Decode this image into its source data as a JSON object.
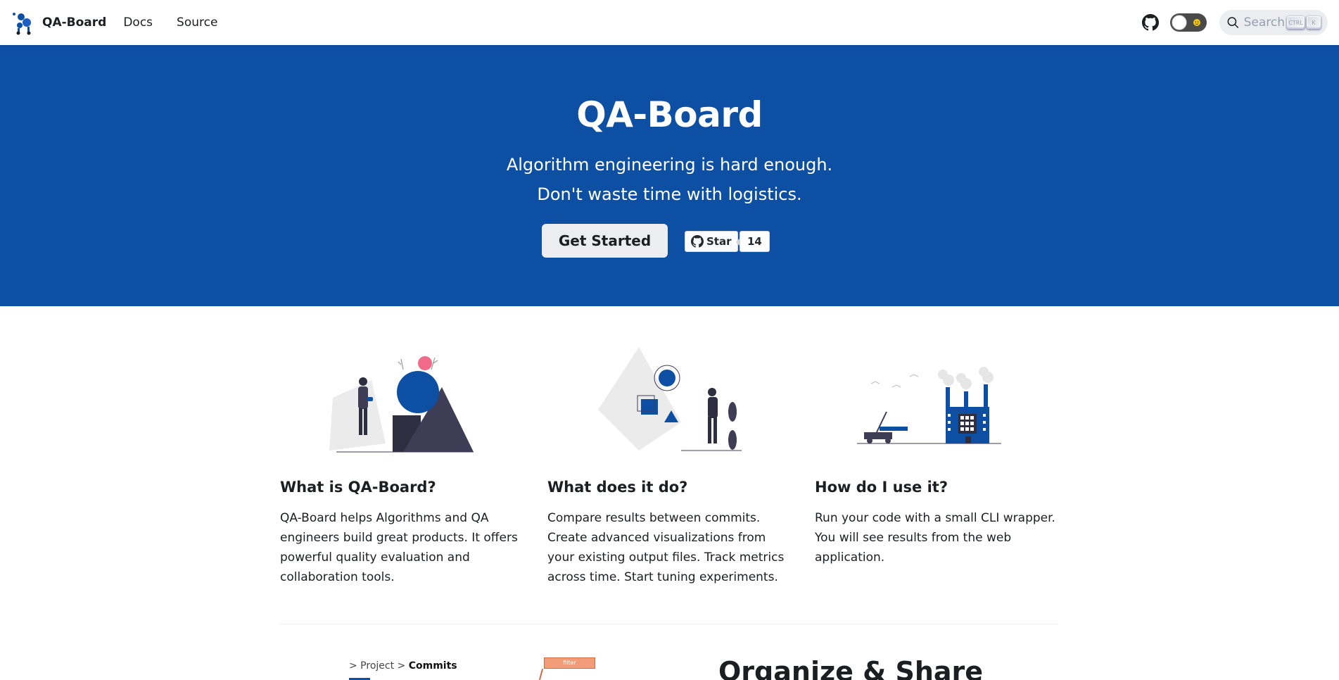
{
  "navbar": {
    "brand_title": "QA-Board",
    "links": [
      "Docs",
      "Source"
    ],
    "search_placeholder": "Search",
    "search_keys": [
      "CTRL",
      "K"
    ]
  },
  "hero": {
    "title": "QA-Board",
    "tagline_line1": "Algorithm engineering is hard enough.",
    "tagline_line2": "Don't waste time with logistics.",
    "cta_label": "Get Started",
    "star_label": "Star",
    "star_count": "14",
    "background_color": "#0d4fa3"
  },
  "features": [
    {
      "title": "What is QA-Board?",
      "body": "QA-Board helps Algorithms and QA engineers build great products. It offers powerful quality evaluation and collaboration tools.",
      "illustration": "person-with-geometric-shapes"
    },
    {
      "title": "What does it do?",
      "body": "Compare results between commits. Create advanced visualizations from your existing output files. Track metrics across time. Start tuning experiments.",
      "illustration": "person-with-shapes-board"
    },
    {
      "title": "How do I use it?",
      "body": "Run your code with a small CLI wrapper. You will see results from the web application.",
      "illustration": "factory-and-truck"
    }
  ],
  "lower": {
    "breadcrumb_prefix": "> Project >",
    "breadcrumb_current": "Commits",
    "filter_label": "filter",
    "section_title": "Organize & Share"
  },
  "colors": {
    "accent": "#0d4fa3",
    "cta_bg": "#ebedf0"
  }
}
